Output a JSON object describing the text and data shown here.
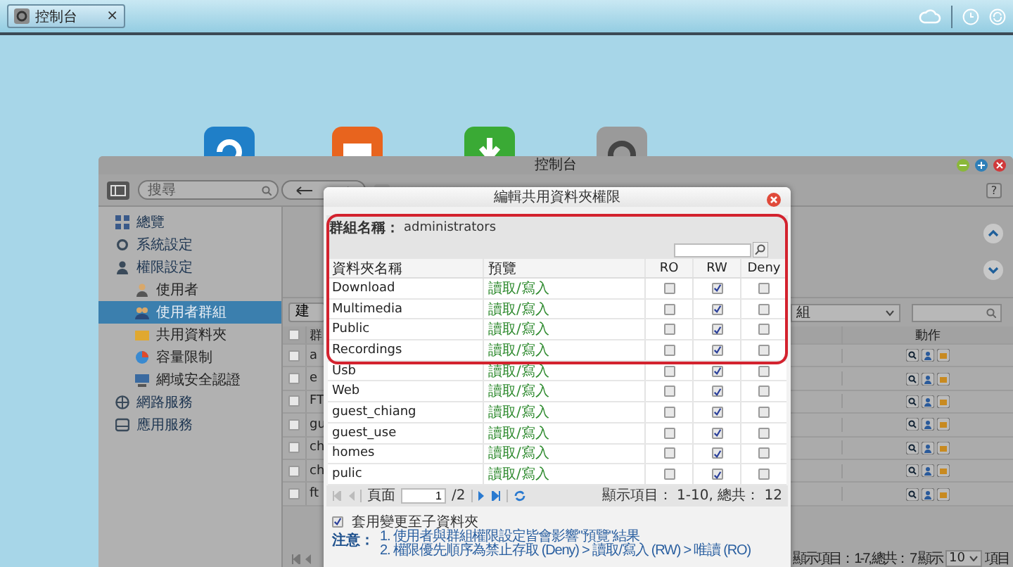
{
  "taskbar": {
    "tab": {
      "title": "控制台",
      "close": "×",
      "selected": true
    }
  },
  "window": {
    "title": "控制台",
    "search": {
      "placeholder": "搜尋"
    },
    "help": "?",
    "sidebar": [
      {
        "label": "總覽",
        "selected": false
      },
      {
        "label": "系統設定",
        "selected": false
      },
      {
        "label": "權限設定",
        "selected": false,
        "children": [
          {
            "label": "使用者",
            "selected": false
          },
          {
            "label": "使用者群組",
            "selected": true
          },
          {
            "label": "共用資料夾",
            "selected": false
          },
          {
            "label": "容量限制",
            "selected": false
          },
          {
            "label": "網域安全認證",
            "selected": false
          }
        ]
      },
      {
        "label": "網路服務",
        "selected": false
      },
      {
        "label": "應用服務",
        "selected": false
      }
    ],
    "create_button": "建",
    "filter": {
      "value": "組"
    },
    "table": {
      "columns": [
        "群",
        "動作"
      ],
      "all_checked": false,
      "rows": [
        {
          "column_2": "a",
          "checked": false
        },
        {
          "column_2": "e",
          "checked": false
        },
        {
          "column_2": "FT",
          "checked": false
        },
        {
          "column_2": "gu",
          "checked": false
        },
        {
          "column_2": "ch",
          "checked": false
        },
        {
          "column_2": "ch",
          "checked": false
        },
        {
          "column_2": "ft",
          "checked": false
        }
      ]
    },
    "footer": {
      "summary": "顯示項目： 1-7, 總共： 7",
      "per_page_label": "顯示",
      "per_page": "10",
      "unit": "項目"
    }
  },
  "dialog": {
    "title": "編輯共用資料夾權限",
    "group_label": "群組名稱：",
    "group_name": "administrators",
    "columns": [
      "資料夾名稱",
      "預覽",
      "RO",
      "RW",
      "Deny"
    ],
    "rows": [
      {
        "name": "Download",
        "preview": "讀取/寫入",
        "ro": false,
        "rw": true,
        "deny": false
      },
      {
        "name": "Multimedia",
        "preview": "讀取/寫入",
        "ro": false,
        "rw": true,
        "deny": false
      },
      {
        "name": "Public",
        "preview": "讀取/寫入",
        "ro": false,
        "rw": true,
        "deny": false
      },
      {
        "name": "Recordings",
        "preview": "讀取/寫入",
        "ro": false,
        "rw": true,
        "deny": false
      },
      {
        "name": "Usb",
        "preview": "讀取/寫入",
        "ro": false,
        "rw": true,
        "deny": false
      },
      {
        "name": "Web",
        "preview": "讀取/寫入",
        "ro": false,
        "rw": true,
        "deny": false
      },
      {
        "name": "guest_chiang",
        "preview": "讀取/寫入",
        "ro": false,
        "rw": true,
        "deny": false
      },
      {
        "name": "guest_use",
        "preview": "讀取/寫入",
        "ro": false,
        "rw": true,
        "deny": false
      },
      {
        "name": "homes",
        "preview": "讀取/寫入",
        "ro": false,
        "rw": true,
        "deny": false
      },
      {
        "name": "pulic",
        "preview": "讀取/寫入",
        "ro": false,
        "rw": true,
        "deny": false
      }
    ],
    "pager": {
      "page_label": "頁面",
      "page": "1",
      "total_pages": "/2",
      "summary": "顯示項目： 1-10, 總共： 12"
    },
    "apply_subfolders": {
      "label": "套用變更至子資料夾",
      "checked": true
    },
    "notes": {
      "label": "注意：",
      "items": [
        "1. 使用者與群組權限設定皆會影響\"預覽\"結果",
        "2. 權限優先順序為禁止存取 (Deny) > 讀取/寫入 (RW) > 唯讀 (RO)"
      ]
    },
    "highlight": true
  }
}
